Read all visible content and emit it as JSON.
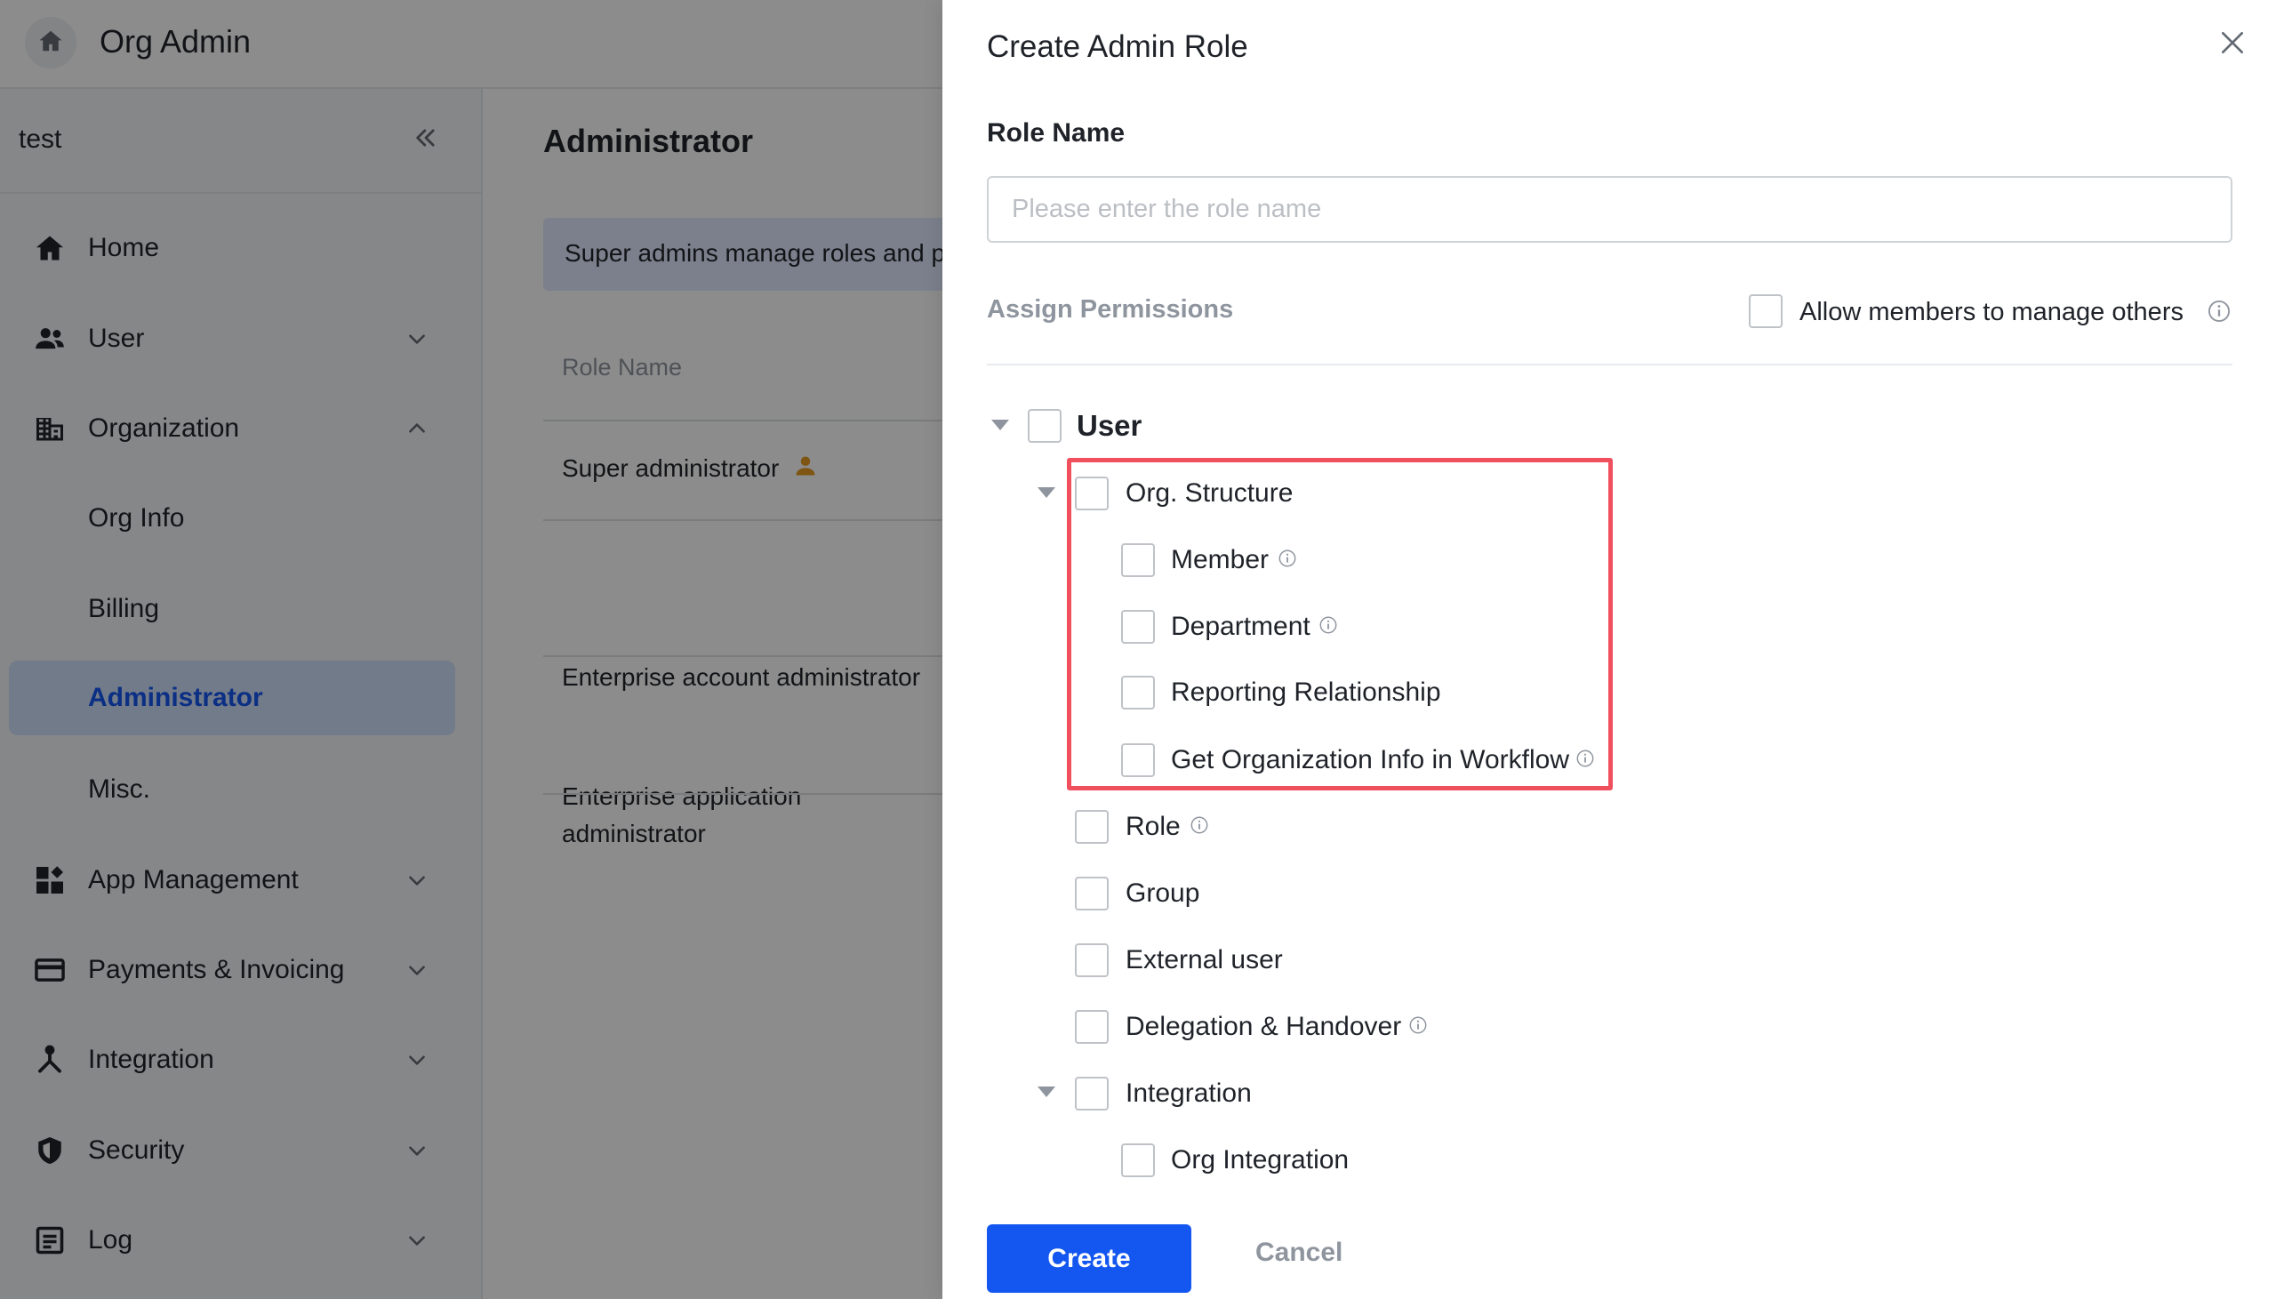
{
  "header": {
    "title": "Org Admin",
    "home_icon": "home-icon"
  },
  "sidebar": {
    "tenant": "test",
    "collapse_icon": "double-chevron-left-icon",
    "items": [
      {
        "label": "Home",
        "icon": "home-icon"
      },
      {
        "label": "User",
        "icon": "users-icon",
        "chevron": "down"
      },
      {
        "label": "Organization",
        "icon": "building-icon",
        "chevron": "up"
      },
      {
        "label": "Org Info"
      },
      {
        "label": "Billing"
      },
      {
        "label": "Administrator",
        "active": true
      },
      {
        "label": "Misc."
      },
      {
        "label": "App Management",
        "icon": "apps-icon",
        "chevron": "down"
      },
      {
        "label": "Payments & Invoicing",
        "icon": "card-icon",
        "chevron": "down"
      },
      {
        "label": "Integration",
        "icon": "integration-icon",
        "chevron": "down"
      },
      {
        "label": "Security",
        "icon": "shield-icon",
        "chevron": "down"
      },
      {
        "label": "Log",
        "icon": "log-icon",
        "chevron": "down"
      }
    ]
  },
  "content": {
    "title": "Administrator",
    "notice": "Super admins manage roles and p",
    "column_header": "Role Name",
    "roles": [
      "Super administrator",
      "Enterprise account administrator",
      "Enterprise application administrator"
    ]
  },
  "drawer": {
    "title": "Create Admin Role",
    "role_name_label": "Role Name",
    "role_name_placeholder": "Please enter the role name",
    "role_name_value": "",
    "assign_permissions_label": "Assign Permissions",
    "allow_members_label": "Allow members to manage others",
    "tree": {
      "root": "User",
      "org_structure": "Org. Structure",
      "member": "Member",
      "department": "Department",
      "reporting": "Reporting Relationship",
      "get_org_info": "Get Organization Info in Workflow",
      "role": "Role",
      "group": "Group",
      "external_user": "External user",
      "delegation": "Delegation & Handover",
      "integration": "Integration",
      "org_integration": "Org Integration"
    },
    "create_label": "Create",
    "cancel_label": "Cancel"
  },
  "colors": {
    "accent": "#1456f0",
    "highlight": "#f0505d",
    "overlay": "rgba(0,0,0,0.45)"
  }
}
